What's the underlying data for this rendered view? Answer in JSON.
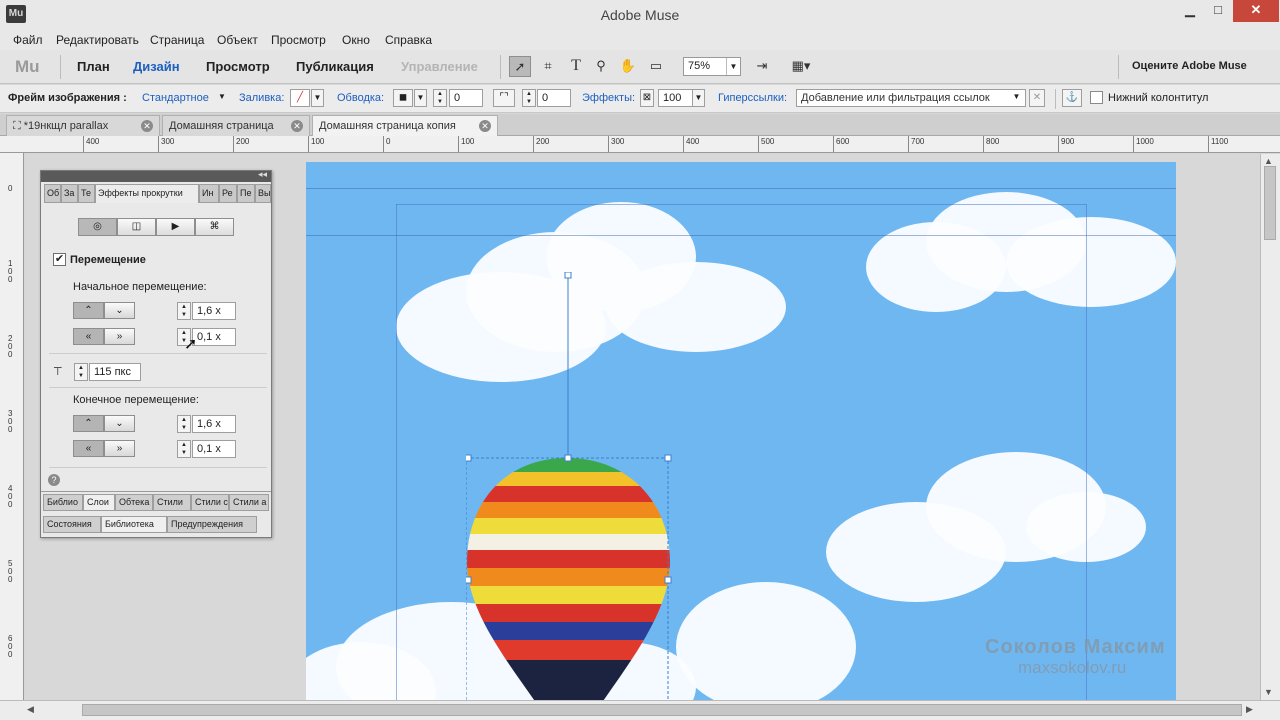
{
  "app": {
    "title": "Adobe Muse",
    "icon_label": "Mu"
  },
  "window_buttons": {
    "minimize": "▁",
    "maximize": "□",
    "close": "✕"
  },
  "menu": [
    "Файл",
    "Редактировать",
    "Страница",
    "Объект",
    "Просмотр",
    "Окно",
    "Справка"
  ],
  "modebar": {
    "logo": "Mu",
    "tabs": [
      "План",
      "Дизайн",
      "Просмотр",
      "Публикация",
      "Управление"
    ],
    "active_tab": "Дизайн",
    "zoom": "75%",
    "rate": "Оцените Adobe Muse",
    "tools": [
      "selection-tool",
      "crop-tool",
      "text-tool",
      "zoom-tool",
      "hand-tool",
      "rectangle-tool"
    ]
  },
  "controlbar": {
    "frame_label": "Фрейм изображения :",
    "frame_value": "Стандартное",
    "fill_label": "Заливка:",
    "stroke_label": "Обводка:",
    "stroke_width": "0",
    "corner_radius": "0",
    "effects_label": "Эффекты:",
    "effects_value": "100",
    "hyperlinks_label": "Гиперссылки:",
    "hyperlinks_placeholder": "Добавление или фильтрация ссылок",
    "footer_label": "Нижний колонтитул"
  },
  "doc_tabs": [
    {
      "label": "*19нкщл parallax"
    },
    {
      "label": "Домашняя страница"
    },
    {
      "label": "Домашняя страница копия"
    }
  ],
  "ruler": {
    "h_labels": [
      "400",
      "300",
      "200",
      "100",
      "0",
      "100",
      "200",
      "300",
      "400",
      "500",
      "600",
      "700",
      "800",
      "900",
      "1000",
      "1100"
    ],
    "v_labels": [
      "0",
      "100",
      "200",
      "300",
      "400",
      "500",
      "600"
    ]
  },
  "panel": {
    "tabs": [
      "Об",
      "За",
      "Те",
      "Эффекты прокрутки",
      "Ин",
      "Ре",
      "Пе",
      "Вы"
    ],
    "active_tab": "Эффекты прокрутки",
    "mode_icons": [
      "scroll-motion-icon",
      "fade-icon",
      "slideshow-icon",
      "widget-icon"
    ],
    "motion_label": "Перемещение",
    "motion_checked": true,
    "initial_label": "Начальное перемещение:",
    "initial_vertical": "1,6 x",
    "initial_horizontal": "0,1 x",
    "key_position": "115 пкс",
    "final_label": "Конечное перемещение:",
    "final_vertical": "1,6 x",
    "final_horizontal": "0,1 x",
    "bottom_tabs_row1": [
      "Библио",
      "Слои",
      "Обтека",
      "Стили",
      "Стили с",
      "Стили а"
    ],
    "bottom_tabs_row2": [
      "Состояния",
      "Библиотека",
      "Предупреждения"
    ]
  },
  "watermark": {
    "name": "Соколов Максим",
    "site": "maxsokolov.ru"
  },
  "colors": {
    "sky": "#6fb7f0",
    "accent": "#1c5fbf",
    "close": "#c7473a"
  }
}
